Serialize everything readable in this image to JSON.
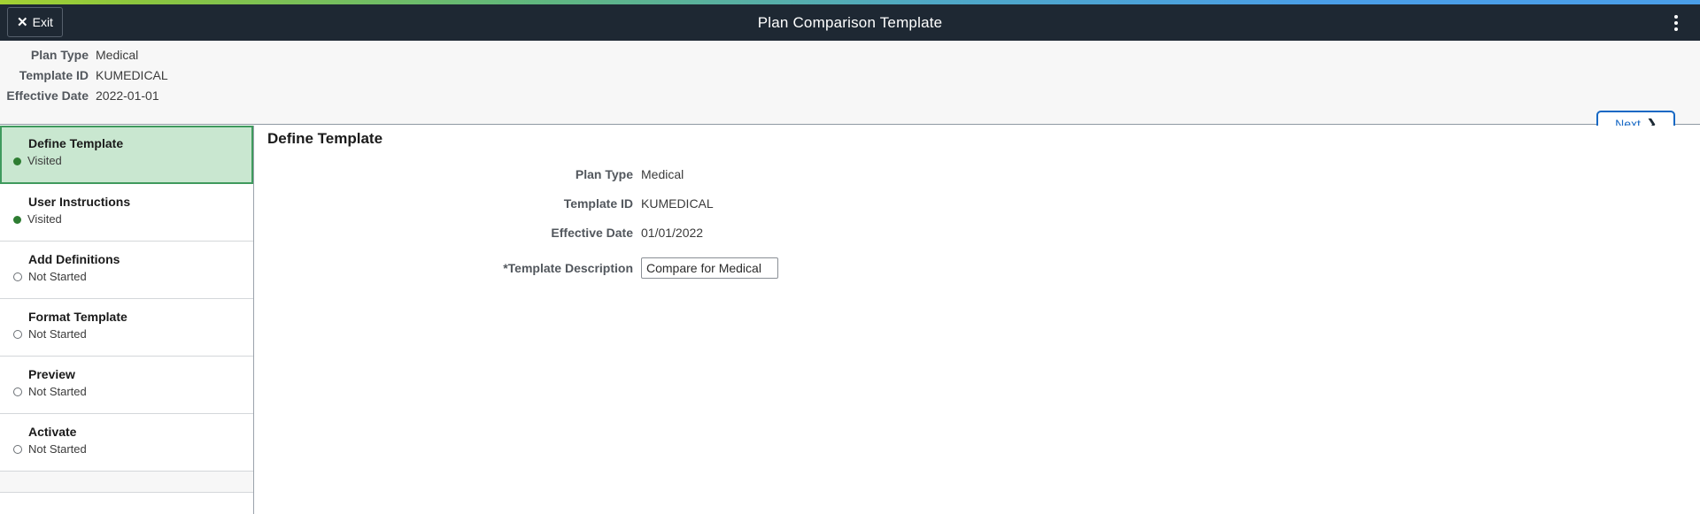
{
  "window": {
    "title": "Plan Comparison Template",
    "exit_label": "Exit",
    "exit_icon": "close-x-icon",
    "menu_icon": "kebab-menu-icon"
  },
  "header": {
    "fields": [
      {
        "label": "Plan Type",
        "value": "Medical"
      },
      {
        "label": "Template ID",
        "value": "KUMEDICAL"
      },
      {
        "label": "Effective Date",
        "value": "2022-01-01"
      }
    ],
    "next_label": "Next",
    "next_icon": "chevron-right-icon"
  },
  "sidebar": {
    "steps": [
      {
        "title": "Define Template",
        "status": "Visited",
        "state": "visited",
        "active": true
      },
      {
        "title": "User Instructions",
        "status": "Visited",
        "state": "visited",
        "active": false
      },
      {
        "title": "Add Definitions",
        "status": "Not Started",
        "state": "not-started",
        "active": false
      },
      {
        "title": "Format Template",
        "status": "Not Started",
        "state": "not-started",
        "active": false
      },
      {
        "title": "Preview",
        "status": "Not Started",
        "state": "not-started",
        "active": false
      },
      {
        "title": "Activate",
        "status": "Not Started",
        "state": "not-started",
        "active": false
      }
    ]
  },
  "main": {
    "page_title": "Define Template",
    "fields": [
      {
        "label": "Plan Type",
        "value": "Medical"
      },
      {
        "label": "Template ID",
        "value": "KUMEDICAL"
      },
      {
        "label": "Effective Date",
        "value": "01/01/2022"
      }
    ],
    "description": {
      "label": "Template Description",
      "required_marker": "*",
      "value": "Compare for Medical",
      "placeholder": ""
    }
  },
  "colors": {
    "titlebar": "#1e2833",
    "accent_blue": "#1768c4",
    "active_step_bg": "#c9e7d0",
    "active_step_border": "#3f9a5d",
    "visited_dot": "#2e7d32"
  }
}
